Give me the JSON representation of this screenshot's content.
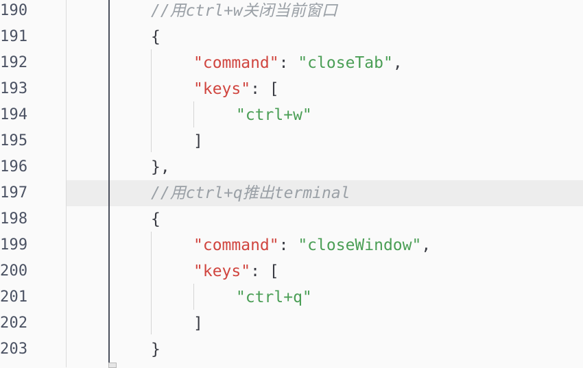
{
  "editor": {
    "lines": [
      {
        "num": "190",
        "highlight": false,
        "tokens": [
          {
            "t": "comment",
            "v": "//用ctrl+w关闭当前窗口"
          }
        ]
      },
      {
        "num": "191",
        "highlight": false,
        "tokens": [
          {
            "t": "punc",
            "v": "{"
          }
        ]
      },
      {
        "num": "192",
        "highlight": false,
        "tokens": [
          {
            "t": "key",
            "v": "\"command\""
          },
          {
            "t": "punc",
            "v": ": "
          },
          {
            "t": "str",
            "v": "\"closeTab\""
          },
          {
            "t": "punc",
            "v": ","
          }
        ]
      },
      {
        "num": "193",
        "highlight": false,
        "tokens": [
          {
            "t": "key",
            "v": "\"keys\""
          },
          {
            "t": "punc",
            "v": ": ["
          }
        ]
      },
      {
        "num": "194",
        "highlight": false,
        "tokens": [
          {
            "t": "str",
            "v": "\"ctrl+w\""
          }
        ]
      },
      {
        "num": "195",
        "highlight": false,
        "tokens": [
          {
            "t": "punc",
            "v": "]"
          }
        ]
      },
      {
        "num": "196",
        "highlight": false,
        "tokens": [
          {
            "t": "punc",
            "v": "},"
          }
        ]
      },
      {
        "num": "197",
        "highlight": true,
        "tokens": [
          {
            "t": "comment",
            "v": "//用ctrl+q推出terminal"
          }
        ]
      },
      {
        "num": "198",
        "highlight": false,
        "tokens": [
          {
            "t": "punc",
            "v": "{"
          }
        ]
      },
      {
        "num": "199",
        "highlight": false,
        "tokens": [
          {
            "t": "key",
            "v": "\"command\""
          },
          {
            "t": "punc",
            "v": ": "
          },
          {
            "t": "str",
            "v": "\"closeWindow\""
          },
          {
            "t": "punc",
            "v": ","
          }
        ]
      },
      {
        "num": "200",
        "highlight": false,
        "tokens": [
          {
            "t": "key",
            "v": "\"keys\""
          },
          {
            "t": "punc",
            "v": ": ["
          }
        ]
      },
      {
        "num": "201",
        "highlight": false,
        "tokens": [
          {
            "t": "str",
            "v": "\"ctrl+q\""
          }
        ]
      },
      {
        "num": "202",
        "highlight": false,
        "tokens": [
          {
            "t": "punc",
            "v": "]"
          }
        ]
      },
      {
        "num": "203",
        "highlight": false,
        "tokens": [
          {
            "t": "punc",
            "v": "}"
          }
        ]
      }
    ],
    "colors": {
      "background": "#fafafa",
      "current_line": "#ededed",
      "comment": "#9aa0a6",
      "key": "#d0453f",
      "string": "#4a9e55",
      "punctuation": "#383a42",
      "line_number": "#4b5263"
    }
  }
}
